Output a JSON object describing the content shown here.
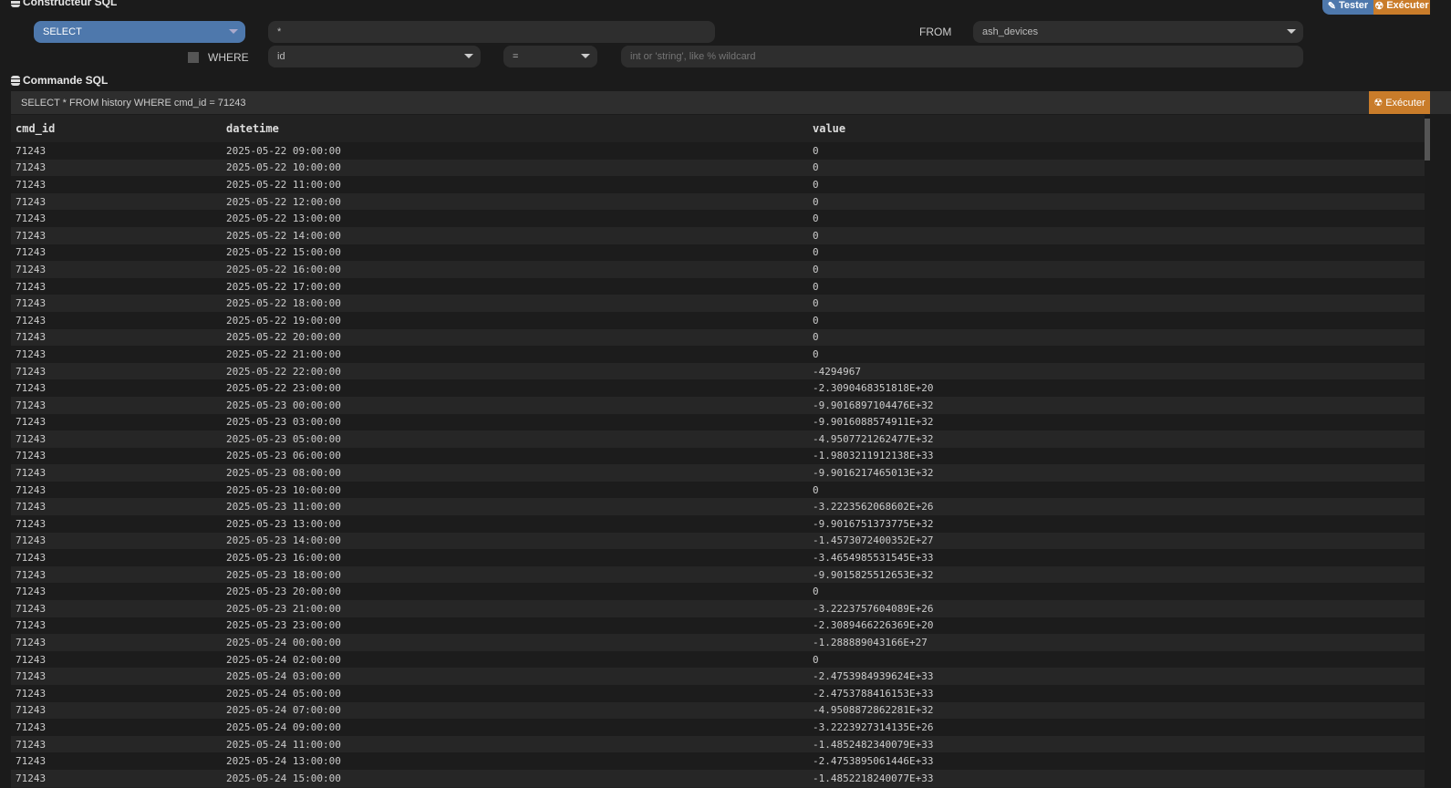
{
  "builder": {
    "title": "Constructeur SQL",
    "select": "SELECT",
    "columns": "*",
    "from_label": "FROM",
    "from_table": "ash_devices",
    "where_label": "WHERE",
    "where_field": "id",
    "where_op": "=",
    "where_value_placeholder": "int or 'string', like % wildcard",
    "tester": "Tester",
    "executer": "Exécuter"
  },
  "command": {
    "title": "Commande SQL",
    "query": "SELECT * FROM history WHERE cmd_id = 71243",
    "execute": "Exécuter"
  },
  "colors": {
    "blue": "#4e78ac",
    "orange": "#c97c2a"
  },
  "table": {
    "headers": [
      "cmd_id",
      "datetime",
      "value"
    ],
    "rows": [
      [
        "71243",
        "2025-05-22 09:00:00",
        "0"
      ],
      [
        "71243",
        "2025-05-22 10:00:00",
        "0"
      ],
      [
        "71243",
        "2025-05-22 11:00:00",
        "0"
      ],
      [
        "71243",
        "2025-05-22 12:00:00",
        "0"
      ],
      [
        "71243",
        "2025-05-22 13:00:00",
        "0"
      ],
      [
        "71243",
        "2025-05-22 14:00:00",
        "0"
      ],
      [
        "71243",
        "2025-05-22 15:00:00",
        "0"
      ],
      [
        "71243",
        "2025-05-22 16:00:00",
        "0"
      ],
      [
        "71243",
        "2025-05-22 17:00:00",
        "0"
      ],
      [
        "71243",
        "2025-05-22 18:00:00",
        "0"
      ],
      [
        "71243",
        "2025-05-22 19:00:00",
        "0"
      ],
      [
        "71243",
        "2025-05-22 20:00:00",
        "0"
      ],
      [
        "71243",
        "2025-05-22 21:00:00",
        "0"
      ],
      [
        "71243",
        "2025-05-22 22:00:00",
        "-4294967"
      ],
      [
        "71243",
        "2025-05-22 23:00:00",
        "-2.3090468351818E+20"
      ],
      [
        "71243",
        "2025-05-23 00:00:00",
        "-9.9016897104476E+32"
      ],
      [
        "71243",
        "2025-05-23 03:00:00",
        "-9.9016088574911E+32"
      ],
      [
        "71243",
        "2025-05-23 05:00:00",
        "-4.9507721262477E+32"
      ],
      [
        "71243",
        "2025-05-23 06:00:00",
        "-1.9803211912138E+33"
      ],
      [
        "71243",
        "2025-05-23 08:00:00",
        "-9.9016217465013E+32"
      ],
      [
        "71243",
        "2025-05-23 10:00:00",
        "0"
      ],
      [
        "71243",
        "2025-05-23 11:00:00",
        "-3.2223562068602E+26"
      ],
      [
        "71243",
        "2025-05-23 13:00:00",
        "-9.9016751373775E+32"
      ],
      [
        "71243",
        "2025-05-23 14:00:00",
        "-1.4573072400352E+27"
      ],
      [
        "71243",
        "2025-05-23 16:00:00",
        "-3.4654985531545E+33"
      ],
      [
        "71243",
        "2025-05-23 18:00:00",
        "-9.9015825512653E+32"
      ],
      [
        "71243",
        "2025-05-23 20:00:00",
        "0"
      ],
      [
        "71243",
        "2025-05-23 21:00:00",
        "-3.2223757604089E+26"
      ],
      [
        "71243",
        "2025-05-23 23:00:00",
        "-2.3089466226369E+20"
      ],
      [
        "71243",
        "2025-05-24 00:00:00",
        "-1.288889043166E+27"
      ],
      [
        "71243",
        "2025-05-24 02:00:00",
        "0"
      ],
      [
        "71243",
        "2025-05-24 03:00:00",
        "-2.4753984939624E+33"
      ],
      [
        "71243",
        "2025-05-24 05:00:00",
        "-2.4753788416153E+33"
      ],
      [
        "71243",
        "2025-05-24 07:00:00",
        "-4.9508872862281E+32"
      ],
      [
        "71243",
        "2025-05-24 09:00:00",
        "-3.2223927314135E+26"
      ],
      [
        "71243",
        "2025-05-24 11:00:00",
        "-1.4852482340079E+33"
      ],
      [
        "71243",
        "2025-05-24 13:00:00",
        "-2.4753895061446E+33"
      ],
      [
        "71243",
        "2025-05-24 15:00:00",
        "-1.4852218240077E+33"
      ]
    ]
  }
}
